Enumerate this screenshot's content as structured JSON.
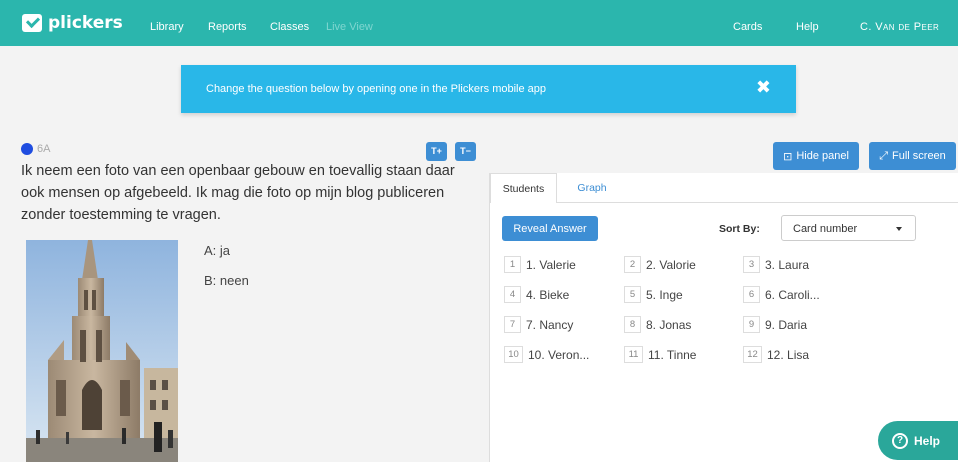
{
  "app": {
    "name": "plickers"
  },
  "nav": {
    "items": [
      {
        "label": "Library"
      },
      {
        "label": "Reports"
      },
      {
        "label": "Classes"
      },
      {
        "label": "Live View"
      }
    ],
    "right": [
      {
        "label": "Cards"
      },
      {
        "label": "Help"
      }
    ],
    "user": "C. Van de Peer"
  },
  "banner": {
    "text": "Change the question below by opening one in the Plickers mobile app",
    "close_icon": "close-icon"
  },
  "question": {
    "class_name": "6A",
    "class_color": "#1f4de0",
    "text_increase_label": "T+",
    "text_decrease_label": "T−",
    "text": "Ik neem een foto van een openbaar gebouw en toevallig staan daar ook mensen op afgebeeld. Ik mag die foto op mijn blog publiceren zonder toestemming te vragen.",
    "answers": [
      "A: ja",
      "B: neen"
    ]
  },
  "panel": {
    "hide_label": "Hide panel",
    "fullscreen_label": "Full screen",
    "tabs": [
      {
        "label": "Students",
        "active": true
      },
      {
        "label": "Graph",
        "active": false
      }
    ],
    "reveal_label": "Reveal Answer",
    "sort_label": "Sort By:",
    "sort_value": "Card number",
    "students": [
      {
        "num": "1",
        "name": "1. Valerie"
      },
      {
        "num": "2",
        "name": "2. Valorie"
      },
      {
        "num": "3",
        "name": "3. Laura"
      },
      {
        "num": "4",
        "name": "4. Bieke"
      },
      {
        "num": "5",
        "name": "5. Inge"
      },
      {
        "num": "6",
        "name": "6. Caroli..."
      },
      {
        "num": "7",
        "name": "7. Nancy"
      },
      {
        "num": "8",
        "name": "8. Jonas"
      },
      {
        "num": "9",
        "name": "9. Daria"
      },
      {
        "num": "10",
        "name": "10. Veron..."
      },
      {
        "num": "11",
        "name": "11. Tinne"
      },
      {
        "num": "12",
        "name": "12. Lisa"
      }
    ]
  },
  "help_button": {
    "label": "Help"
  },
  "colors": {
    "topbar": "#2bb6ad",
    "banner": "#29b7e8",
    "primary": "#3d8ed4",
    "help": "#2aa79a"
  }
}
